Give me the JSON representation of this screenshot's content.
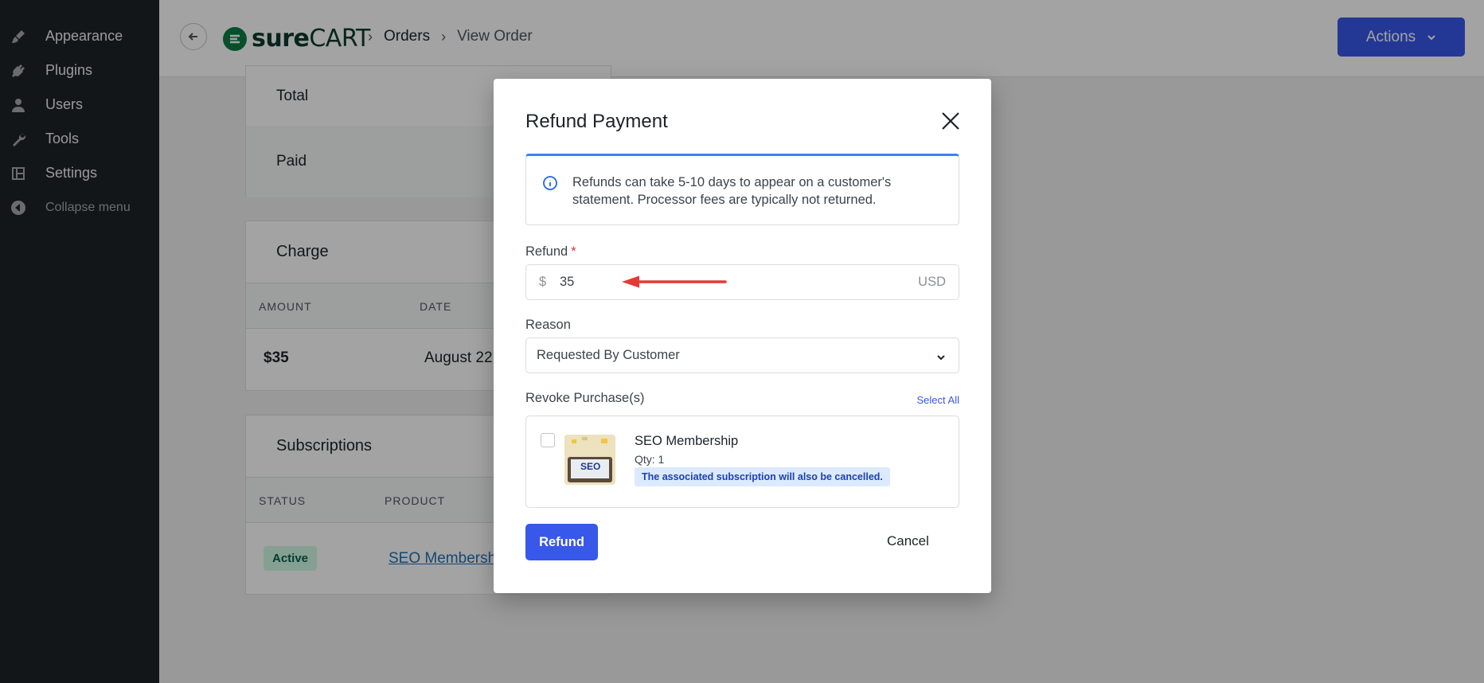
{
  "sidebar": {
    "items": [
      {
        "label": "Appearance",
        "icon": "paintbrush-icon"
      },
      {
        "label": "Plugins",
        "icon": "plugin-icon"
      },
      {
        "label": "Users",
        "icon": "user-icon"
      },
      {
        "label": "Tools",
        "icon": "wrench-icon"
      },
      {
        "label": "Settings",
        "icon": "settings-icon"
      }
    ],
    "collapse_label": "Collapse menu"
  },
  "header": {
    "logo_bold": "sure",
    "logo_thin": "CART",
    "breadcrumbs": [
      "Orders",
      "View Order"
    ],
    "actions_label": "Actions"
  },
  "background": {
    "total_label": "Total",
    "paid_label": "Paid",
    "charge": {
      "title": "Charge",
      "columns": [
        "AMOUNT",
        "DATE"
      ],
      "amount": "$35",
      "date": "August 22,"
    },
    "subscriptions": {
      "title": "Subscriptions",
      "columns": [
        "STATUS",
        "PRODUCT"
      ],
      "status": "Active",
      "product": "SEO Membershi"
    }
  },
  "modal": {
    "title": "Refund Payment",
    "notice": "Refunds can take 5-10 days to appear on a customer's statement. Processor fees are typically not returned.",
    "refund_label": "Refund",
    "required_mark": "*",
    "currency_prefix": "$",
    "refund_value": "35",
    "currency_suffix": "USD",
    "reason_label": "Reason",
    "reason_value": "Requested By Customer",
    "revoke_label": "Revoke Purchase(s)",
    "select_all": "Select All",
    "purchase": {
      "name": "SEO Membership",
      "qty": "Qty: 1",
      "note": "The associated subscription will also be cancelled.",
      "thumb_text": "SEO"
    },
    "refund_button": "Refund",
    "cancel_button": "Cancel"
  },
  "colors": {
    "primary": "#3858e9",
    "sidebar_bg": "#1d2327",
    "annotation_arrow": "#e53935"
  }
}
